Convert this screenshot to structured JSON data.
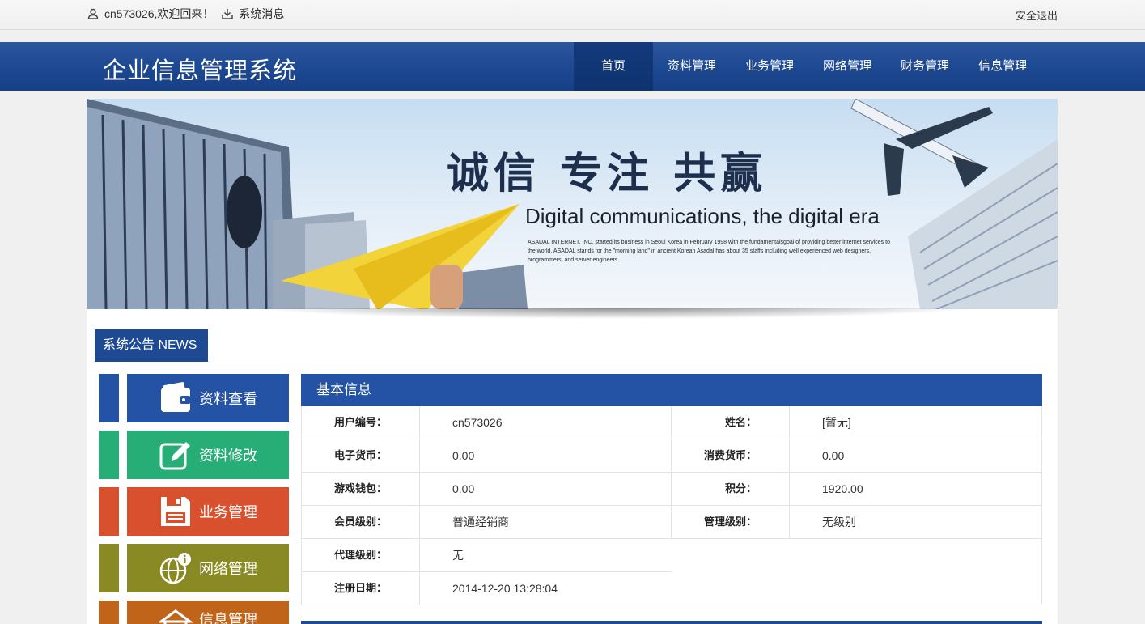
{
  "topbar": {
    "welcome": "cn573026,欢迎回来！",
    "messages": "系统消息",
    "logout": "安全退出"
  },
  "header": {
    "title": "企业信息管理系统",
    "nav": [
      "首页",
      "资料管理",
      "业务管理",
      "网络管理",
      "财务管理",
      "信息管理"
    ],
    "active_index": 0
  },
  "banner": {
    "slogan": "诚信 专注 共赢",
    "headline": "Digital communications, the digital era",
    "body": "ASADAL INTERNET, INC. started its business in Seoul Korea in February 1998 with the fundamentalsgoal of providing better internet services to the world. ASADAL stands for the \"morning land\" in ancient Korean Asadal has about 35 staffs including well experienced web designers, programmers, and server engineers."
  },
  "news_tab": "系统公告 NEWS",
  "side_tiles": [
    {
      "label": "资料查看",
      "icon": "wallet-icon",
      "color": "#2453a6"
    },
    {
      "label": "资料修改",
      "icon": "edit-icon",
      "color": "#27ae77"
    },
    {
      "label": "业务管理",
      "icon": "save-icon",
      "color": "#d9502e"
    },
    {
      "label": "网络管理",
      "icon": "globe-info-icon",
      "color": "#8a8a25"
    },
    {
      "label": "信息管理",
      "icon": "building-icon",
      "color": "#c0641a"
    }
  ],
  "info": {
    "heading": "基本信息",
    "rows": [
      {
        "l1": "用户编号：",
        "v1": "cn573026",
        "l2": "姓名：",
        "v2": "[暂无]"
      },
      {
        "l1": "电子货币：",
        "v1": "0.00",
        "l2": "消费货币：",
        "v2": "0.00"
      },
      {
        "l1": "游戏钱包：",
        "v1": "0.00",
        "l2": "积分：",
        "v2": "1920.00"
      },
      {
        "l1": "会员级别：",
        "v1": "普通经销商",
        "l2": "管理级别：",
        "v2": "无级别"
      }
    ],
    "half_rows": [
      {
        "l1": "代理级别：",
        "v1": "无"
      },
      {
        "l1": "注册日期：",
        "v1": "2014-12-20 13:28:04"
      }
    ]
  }
}
